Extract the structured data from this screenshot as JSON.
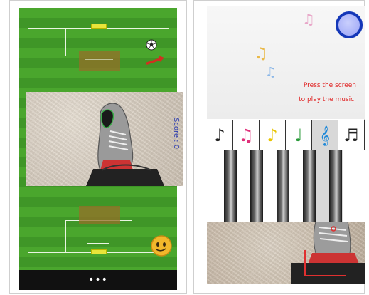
{
  "soccer": {
    "score_text": "Score : 0",
    "nav_text": "•••",
    "icons": [
      "soccer-ball-icon",
      "arrow-icon",
      "smiley-face-icon",
      "foot-icon"
    ]
  },
  "piano": {
    "hint_line1": "Press the screen",
    "hint_line2": "to play the music.",
    "notes": [
      {
        "glyph": "♪",
        "color": "#222222"
      },
      {
        "glyph": "♫",
        "color": "#e0307a"
      },
      {
        "glyph": "♪",
        "color": "#e8c400"
      },
      {
        "glyph": "♩",
        "color": "#2a9a3a"
      },
      {
        "glyph": "𝄞",
        "color": "#1e88d8"
      },
      {
        "glyph": "♬",
        "color": "#222222"
      }
    ],
    "active_note_index": 4,
    "floating_notes": [
      {
        "glyph": "♫",
        "color": "#e8a6c8"
      },
      {
        "glyph": "♫",
        "color": "#e9b949"
      },
      {
        "glyph": "♫",
        "color": "#8bb7e8"
      }
    ]
  },
  "colors": {
    "field_green": "#4aa62d",
    "goal_yellow": "#e8e53a",
    "score_blue": "#2f3fb0",
    "hint_red": "#e02020",
    "button_blue": "#1437b8"
  }
}
